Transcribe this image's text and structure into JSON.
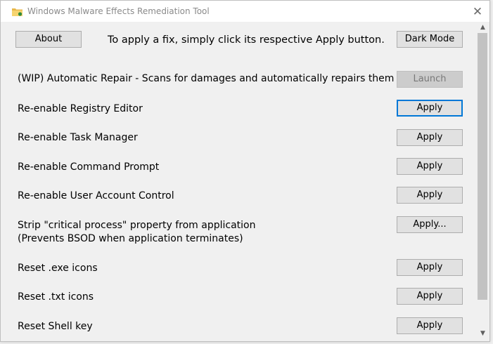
{
  "window": {
    "title": "Windows Malware Effects Remediation Tool",
    "app_icon": "folder-icon",
    "close_symbol": "✕"
  },
  "header": {
    "about_label": "About",
    "instruction": "To apply a fix, simply click its respective Apply button.",
    "dark_mode_label": "Dark Mode"
  },
  "rows": [
    {
      "label": "(WIP) Automatic Repair - Scans for damages and automatically repairs them",
      "button": "Launch",
      "state": "disabled"
    },
    {
      "label": "Re-enable Registry Editor",
      "button": "Apply",
      "state": "focused"
    },
    {
      "label": "Re-enable Task Manager",
      "button": "Apply",
      "state": "normal"
    },
    {
      "label": "Re-enable Command Prompt",
      "button": "Apply",
      "state": "normal"
    },
    {
      "label": "Re-enable User Account Control",
      "button": "Apply",
      "state": "normal"
    },
    {
      "label": "Strip \"critical process\" property from application",
      "sublabel": "(Prevents BSOD when application terminates)",
      "button": "Apply...",
      "state": "normal"
    },
    {
      "label": "Reset .exe icons",
      "button": "Apply",
      "state": "normal"
    },
    {
      "label": "Reset .txt icons",
      "button": "Apply",
      "state": "normal"
    },
    {
      "label": "Reset Shell key",
      "button": "Apply",
      "state": "normal"
    }
  ],
  "scrollbar": {
    "up_symbol": "▲",
    "down_symbol": "▼"
  },
  "colors": {
    "focus_border": "#0078d7",
    "button_face": "#e1e1e1",
    "disabled_face": "#cccccc",
    "window_bg": "#f0f0f0"
  }
}
